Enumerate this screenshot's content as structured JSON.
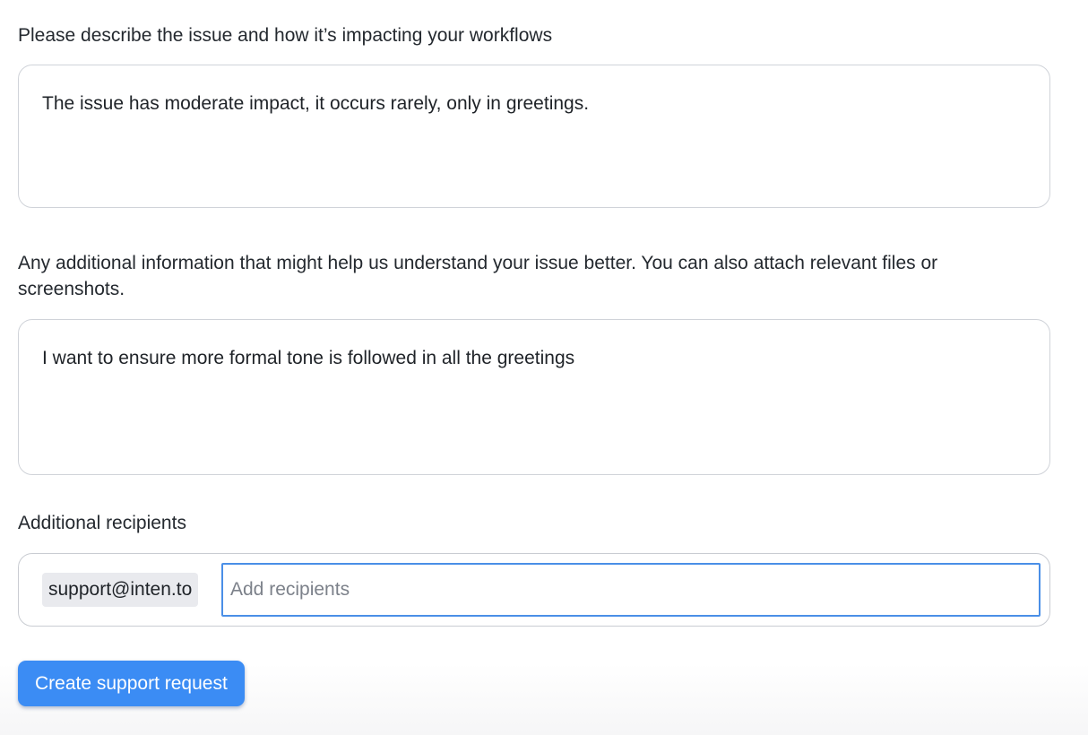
{
  "form": {
    "issue_description": {
      "label": "Please describe the issue and how it’s impacting your workflows",
      "value": "The issue has moderate impact, it occurs rarely, only in greetings."
    },
    "additional_info": {
      "label": "Any additional information that might help us understand your issue better. You can also attach relevant files or screenshots.",
      "value": "I want to ensure more formal tone is followed in all the greetings"
    },
    "recipients": {
      "label": "Additional recipients",
      "chips": [
        "support@inten.to"
      ],
      "placeholder": "Add recipients",
      "value": ""
    },
    "submit_label": "Create support request"
  },
  "colors": {
    "accent": "#3b8cf4",
    "focus_border": "#4a8fe7",
    "chip_background": "#e9eaee",
    "field_border": "#d0d3d9"
  }
}
